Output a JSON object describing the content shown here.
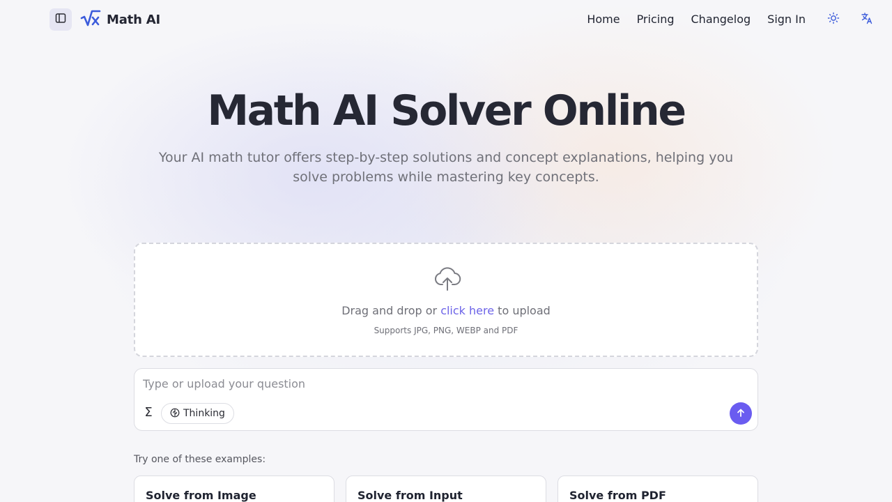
{
  "brand": {
    "name": "Math AI",
    "accent": "#3b5bdb"
  },
  "header": {
    "nav": [
      "Home",
      "Pricing",
      "Changelog",
      "Sign In"
    ],
    "sidebar_toggle_icon": "sidebar-icon",
    "theme_icon": "sun-icon",
    "language_icon": "translate-icon"
  },
  "hero": {
    "title": "Math AI Solver Online",
    "subtitle": "Your AI math tutor offers step-by-step solutions and concept explanations, helping you solve problems while mastering key concepts."
  },
  "upload": {
    "icon": "cloud-upload-icon",
    "text_before": "Drag and drop or ",
    "link": "click here",
    "text_after": " to upload",
    "hint": "Supports JPG, PNG, WEBP and PDF"
  },
  "question": {
    "placeholder": "Type or upload your question",
    "value": "",
    "formula_icon": "sigma-icon",
    "thinking_label": "Thinking",
    "send_icon": "arrow-up-icon",
    "send_color": "#6a5cf0"
  },
  "examples": {
    "label": "Try one of these examples:",
    "cards": [
      "Solve from Image",
      "Solve from Input",
      "Solve from PDF"
    ]
  }
}
